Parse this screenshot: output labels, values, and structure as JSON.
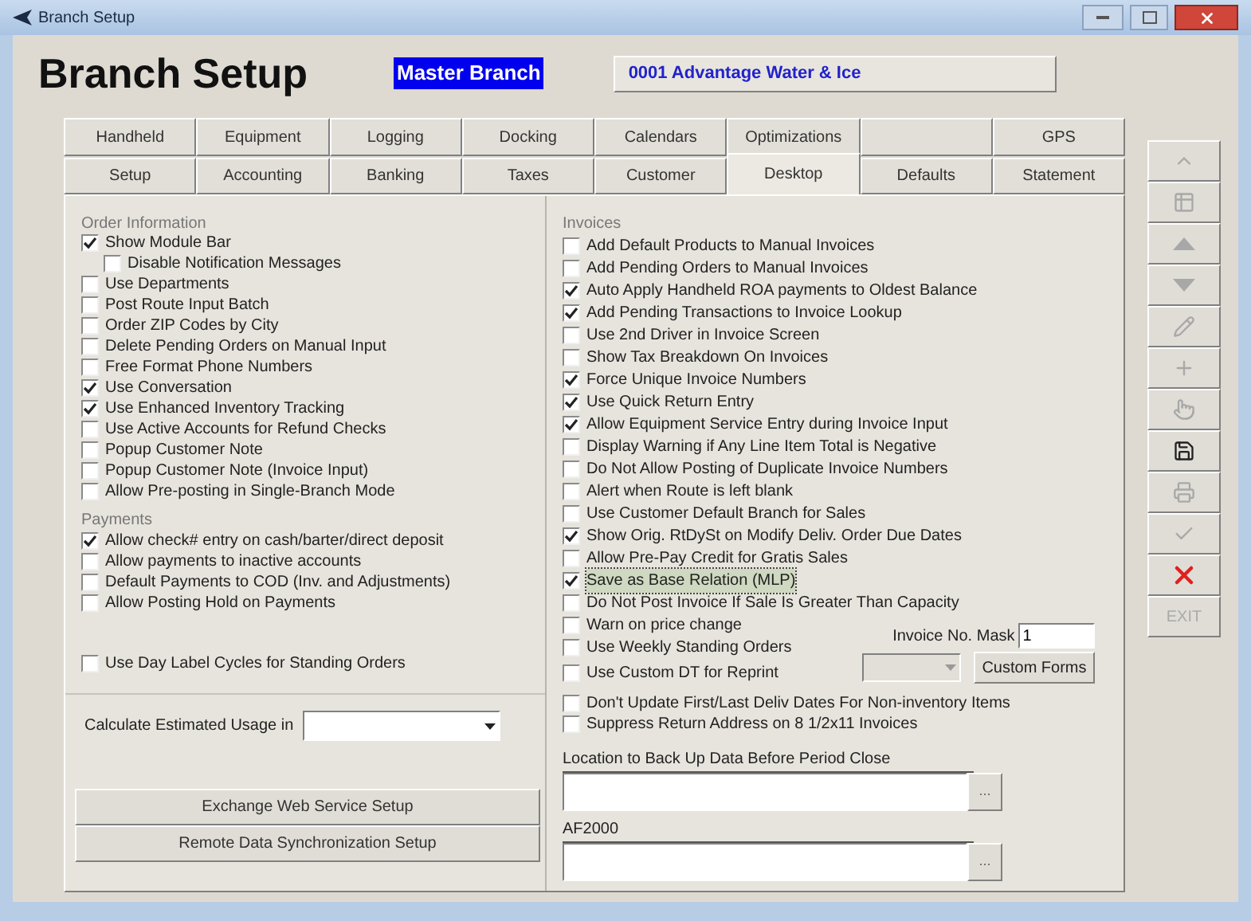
{
  "window": {
    "title": "Branch Setup"
  },
  "header": {
    "title": "Branch Setup",
    "branch_label": "Master Branch",
    "branch_name": "0001  Advantage Water & Ice"
  },
  "tabs_row1": [
    {
      "label": "Handheld",
      "disabled": false
    },
    {
      "label": "Equipment",
      "disabled": false
    },
    {
      "label": "Logging",
      "disabled": false
    },
    {
      "label": "Docking",
      "disabled": false
    },
    {
      "label": "Calendars",
      "disabled": false
    },
    {
      "label": "Optimizations",
      "disabled": false
    },
    {
      "disabled": true
    },
    {
      "label": "GPS",
      "disabled": false
    }
  ],
  "tabs_row2": [
    {
      "label": "Setup",
      "selected": false
    },
    {
      "label": "Accounting",
      "selected": false
    },
    {
      "label": "Banking",
      "selected": false
    },
    {
      "label": "Taxes",
      "selected": false
    },
    {
      "label": "Customer",
      "selected": false
    },
    {
      "label": "Desktop",
      "selected": true
    },
    {
      "label": "Defaults",
      "selected": false
    },
    {
      "label": "Statement",
      "selected": false
    }
  ],
  "order_information": {
    "title": "Order Information",
    "options": [
      {
        "label": "Show Module Bar",
        "checked": true,
        "children": [
          {
            "label": "Disable Notification Messages",
            "checked": false
          }
        ]
      },
      {
        "label": "Use Departments",
        "checked": false
      },
      {
        "label": "Post Route Input Batch",
        "checked": false
      },
      {
        "label": "Order ZIP Codes by City",
        "checked": false
      },
      {
        "label": "Delete Pending Orders on Manual Input",
        "checked": false
      },
      {
        "label": "Free Format Phone Numbers",
        "checked": false
      },
      {
        "label": "Use Conversation",
        "checked": true
      },
      {
        "label": "Use Enhanced Inventory Tracking",
        "checked": true
      },
      {
        "label": "Use Active Accounts for Refund Checks",
        "checked": false
      },
      {
        "label": "Popup Customer Note",
        "checked": false
      },
      {
        "label": "Popup Customer Note (Invoice Input)",
        "checked": false
      },
      {
        "label": "Allow Pre-posting in Single-Branch Mode",
        "checked": false
      }
    ]
  },
  "payments": {
    "title": "Payments",
    "options": [
      {
        "label": "Allow check# entry on cash/barter/direct deposit",
        "checked": true
      },
      {
        "label": "Allow payments to inactive accounts",
        "checked": false
      },
      {
        "label": "Default Payments to COD (Inv. and Adjustments)",
        "checked": false
      },
      {
        "label": "Allow Posting Hold on Payments",
        "checked": false
      }
    ]
  },
  "day_label_cycles": {
    "label": "Use Day Label Cycles for Standing Orders",
    "checked": false
  },
  "estimated_usage": {
    "label": "Calculate Estimated Usage in"
  },
  "left_buttons": [
    "Exchange Web Service Setup",
    "Remote Data Synchronization Setup"
  ],
  "invoices": {
    "title": "Invoices",
    "options": [
      {
        "label": "Add Default Products to Manual Invoices",
        "checked": false,
        "focused": false
      },
      {
        "label": "Add Pending Orders to Manual Invoices",
        "checked": false,
        "focused": false
      },
      {
        "label": "Auto Apply Handheld ROA payments to Oldest Balance",
        "checked": true,
        "focused": false
      },
      {
        "label": "Add Pending Transactions to Invoice Lookup",
        "checked": true,
        "focused": false
      },
      {
        "label": "Use 2nd Driver in Invoice Screen",
        "checked": false,
        "focused": false
      },
      {
        "label": "Show Tax Breakdown On Invoices",
        "checked": false,
        "focused": false
      },
      {
        "label": "Force Unique Invoice Numbers",
        "checked": true,
        "focused": false
      },
      {
        "label": "Use Quick Return Entry",
        "checked": true,
        "focused": false
      },
      {
        "label": "Allow Equipment Service Entry during Invoice Input",
        "checked": true,
        "focused": false
      },
      {
        "label": "Display Warning if Any Line Item Total is Negative",
        "checked": false,
        "focused": false
      },
      {
        "label": "Do Not Allow Posting of Duplicate Invoice Numbers",
        "checked": false,
        "focused": false
      },
      {
        "label": "Alert when Route is left blank",
        "checked": false,
        "focused": false
      },
      {
        "label": "Use Customer Default Branch for Sales",
        "checked": false,
        "focused": false
      },
      {
        "label": "Show Orig. RtDySt on Modify Deliv. Order Due Dates",
        "checked": true,
        "focused": false
      },
      {
        "label": "Allow Pre-Pay Credit for Gratis Sales",
        "checked": false,
        "focused": false
      },
      {
        "label": "Save as Base Relation (MLP)",
        "checked": true,
        "focused": true
      },
      {
        "label": "Do Not Post Invoice If Sale Is Greater Than Capacity",
        "checked": false,
        "focused": false
      }
    ]
  },
  "warn_price_change": {
    "label": "Warn on price change",
    "checked": false
  },
  "weekly_standing_orders": {
    "label": "Use Weekly Standing Orders",
    "checked": false
  },
  "invoice_mask": {
    "label": "Invoice No. Mask",
    "value": "1"
  },
  "custom_dt_reprint": {
    "label": "Use Custom DT for Reprint",
    "checked": false
  },
  "custom_forms_button": "Custom Forms",
  "more_invoice_options": [
    {
      "label": "Don't Update First/Last Deliv Dates For Non-inventory Items",
      "checked": false
    },
    {
      "label": "Suppress Return Address on 8 1/2x11 Invoices",
      "checked": false
    }
  ],
  "path_fields": [
    {
      "label": "Location to Back Up Data Before Period Close",
      "browse": "..."
    },
    {
      "label": "AF2000",
      "browse": "..."
    }
  ],
  "toolbar": [
    {
      "kind": "top",
      "disabled": true
    },
    {
      "kind": "list",
      "disabled": true
    },
    {
      "kind": "up",
      "disabled": true
    },
    {
      "kind": "down",
      "disabled": true
    },
    {
      "kind": "edit",
      "disabled": true
    },
    {
      "kind": "add",
      "disabled": true
    },
    {
      "kind": "pointer",
      "disabled": true
    },
    {
      "kind": "save",
      "disabled": false
    },
    {
      "kind": "print",
      "disabled": true
    },
    {
      "kind": "check",
      "disabled": true
    },
    {
      "kind": "delete",
      "disabled": false
    },
    {
      "kind": "text",
      "label": "EXIT",
      "disabled": true
    }
  ]
}
